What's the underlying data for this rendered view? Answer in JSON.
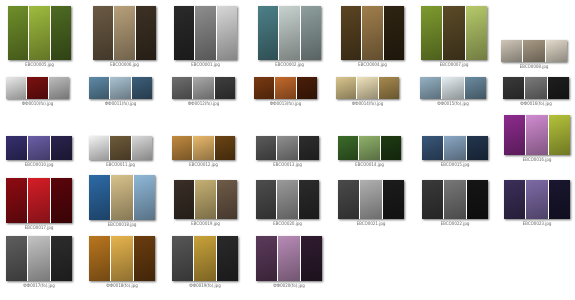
{
  "files": [
    {
      "name": "ЕВСО0005.jpg",
      "colors": [
        "#6f8f2a",
        "#9fbc3e",
        "#4e6b22"
      ]
    },
    {
      "name": "ЕВСО0006.jpg",
      "colors": [
        "#6b5a44",
        "#b7a07a",
        "#3d3124"
      ]
    },
    {
      "name": "ЕВСО0001.jpg",
      "colors": [
        "#2a2a2a",
        "#8d8d8d",
        "#d7d7d7"
      ]
    },
    {
      "name": "ЕВСО0002.jpg",
      "colors": [
        "#4c8087",
        "#c7d2cf",
        "#8e9f9e"
      ]
    },
    {
      "name": "ЕВСО0004.jpg",
      "colors": [
        "#5b4422",
        "#a07e4b",
        "#2f2412"
      ]
    },
    {
      "name": "ЕВСО0007.jpg",
      "colors": [
        "#7e9b2f",
        "#5b4a27",
        "#b6c96a"
      ]
    },
    {
      "name": "ЕВСО0008.jpg",
      "colors": [
        "#cfc6b7",
        "#a99b86",
        "#e3dbcc"
      ]
    },
    {
      "name": "ФФ0010(fo).jpg",
      "colors": [
        "#e9e9e9",
        "#7b1010",
        "#bdbdbd"
      ]
    },
    {
      "name": "ФФ0011(fo).jpg",
      "colors": [
        "#5f8aa7",
        "#a9c3d3",
        "#3d5f7b"
      ]
    },
    {
      "name": "ФФ0012(fo).jpg",
      "colors": [
        "#6f6f6f",
        "#a9a9a9",
        "#3f3f3f"
      ]
    },
    {
      "name": "ФФ0013(fo).jpg",
      "colors": [
        "#7b3a12",
        "#c3692b",
        "#4c1e09"
      ]
    },
    {
      "name": "ФФ0014(fo).jpg",
      "colors": [
        "#d9c58d",
        "#efe2b9",
        "#a78a4d"
      ]
    },
    {
      "name": "ФФ0015(fo).jpg",
      "colors": [
        "#94b2c4",
        "#e5eef2",
        "#6b8ba0"
      ]
    },
    {
      "name": "ФФ0016(fo).jpg",
      "colors": [
        "#3a3a3a",
        "#7a7a7a",
        "#1e1e1e"
      ]
    },
    {
      "name": "ЕВСО0010.jpg",
      "colors": [
        "#37306f",
        "#6b5fa8",
        "#2b244f"
      ]
    },
    {
      "name": "ЕВСО0011.jpg",
      "colors": [
        "#f3f3f3",
        "#6f5b3a",
        "#dadada"
      ]
    },
    {
      "name": "ЕВСО0012.jpg",
      "colors": [
        "#c18a3f",
        "#e8b86b",
        "#6b4414"
      ]
    },
    {
      "name": "ЕВСО0013.jpg",
      "colors": [
        "#5b5b5b",
        "#8f8f8f",
        "#2e2e2e"
      ]
    },
    {
      "name": "ЕВСО0014.jpg",
      "colors": [
        "#3c6b2a",
        "#8fb26a",
        "#1f3b14"
      ]
    },
    {
      "name": "ЕВСО0015.jpg",
      "colors": [
        "#39577a",
        "#8aa7c4",
        "#23364f"
      ]
    },
    {
      "name": "ЕВСО0016.jpg",
      "colors": [
        "#8e2b8e",
        "#d08bd0",
        "#b4c23a"
      ]
    },
    {
      "name": "ЕВСО0017.jpg",
      "colors": [
        "#8d0b12",
        "#d51d26",
        "#5b050a"
      ]
    },
    {
      "name": "ЕВСО0018.jpg",
      "colors": [
        "#2d6aa6",
        "#d8c28b",
        "#8fb8d8"
      ]
    },
    {
      "name": "ЕВСО0019.jpg",
      "colors": [
        "#3a2f27",
        "#c5b073",
        "#6f5b48"
      ]
    },
    {
      "name": "ЕВСО0020.jpg",
      "colors": [
        "#4d4d4d",
        "#9a9a9a",
        "#2b2b2b"
      ]
    },
    {
      "name": "ЕВСО0021.jpg",
      "colors": [
        "#4a4a4a",
        "#b0b0b0",
        "#1c1c1c"
      ]
    },
    {
      "name": "ЕВСО0022.jpg",
      "colors": [
        "#3a3a3a",
        "#777777",
        "#151515"
      ]
    },
    {
      "name": "ЕВСО0023.jpg",
      "colors": [
        "#3c2f5a",
        "#7d6aa6",
        "#1a1630"
      ]
    },
    {
      "name": "ФФ0017(fo).jpg",
      "colors": [
        "#5e5e5e",
        "#c3c3c3",
        "#2d2d2d"
      ]
    },
    {
      "name": "ФФ0018(fo).jpg",
      "colors": [
        "#b9761f",
        "#e6b44d",
        "#6b3d0f"
      ]
    },
    {
      "name": "ФФ0019(fo).jpg",
      "colors": [
        "#575757",
        "#c8a23a",
        "#2a2a2a"
      ]
    },
    {
      "name": "ФФ0020(fo).jpg",
      "colors": [
        "#5c3a5b",
        "#b78bb6",
        "#2f1c2f"
      ]
    }
  ]
}
